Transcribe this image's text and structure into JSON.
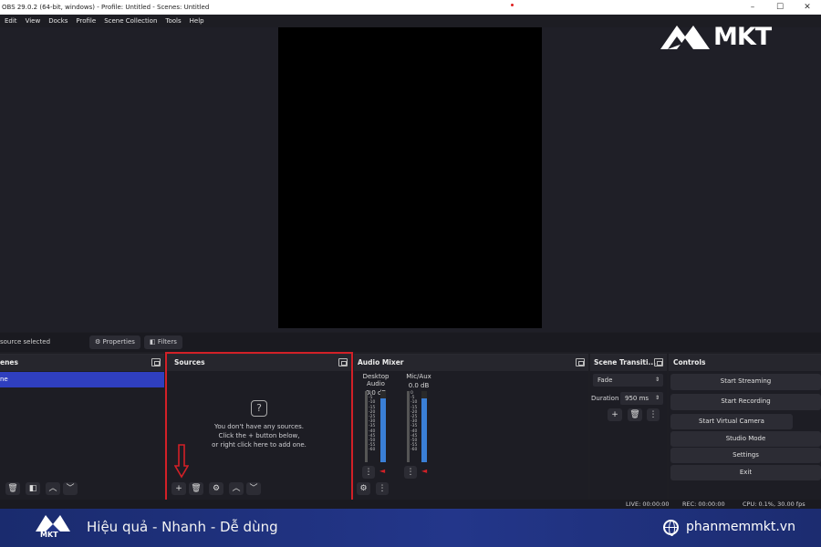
{
  "window": {
    "title": "OBS 29.0.2 (64-bit, windows) - Profile: Untitled - Scenes: Untitled",
    "minimize": "–",
    "maximize": "☐",
    "close": "✕"
  },
  "menu": [
    "Edit",
    "View",
    "Docks",
    "Profile",
    "Scene Collection",
    "Tools",
    "Help"
  ],
  "brand": {
    "logo_text": "MKT"
  },
  "statusrow": {
    "selected": "source selected",
    "properties": "Properties",
    "filters": "Filters"
  },
  "scenes": {
    "title": "enes",
    "item": "ne"
  },
  "sources": {
    "title": "Sources",
    "empty_icon": "?",
    "empty_line1": "You don't have any sources.",
    "empty_line2": "Click the + button below,",
    "empty_line3": "or right click here to add one."
  },
  "mixer": {
    "title": "Audio Mixer",
    "channels": [
      {
        "name": "Desktop Audio",
        "db": "0.0 dB",
        "level": 0.9
      },
      {
        "name": "Mic/Aux",
        "db": "0.0 dB",
        "level": 0.9
      }
    ],
    "scale": [
      "0",
      "-5",
      "-10",
      "-15",
      "-20",
      "-25",
      "-30",
      "-35",
      "-40",
      "-45",
      "-50",
      "-55",
      "-60"
    ]
  },
  "transitions": {
    "title": "Scene Transiti...",
    "type": "Fade",
    "duration_label": "Duration",
    "duration_value": "950 ms"
  },
  "controls": {
    "title": "Controls",
    "buttons": [
      "Start Streaming",
      "Start Recording",
      "Start Virtual Camera",
      "Studio Mode",
      "Settings",
      "Exit"
    ]
  },
  "status": {
    "live": "LIVE: 00:00:00",
    "rec": "REC: 00:00:00",
    "cpu": "CPU: 0.1%, 30.00 fps"
  },
  "banner": {
    "tagline": "Hiệu quả - Nhanh - Dễ dùng",
    "site": "phanmemmkt.vn",
    "logo_text": "MKT"
  },
  "colors": {
    "accent": "#2f3fbf",
    "highlight": "#d22027",
    "banner": "#23368a"
  }
}
